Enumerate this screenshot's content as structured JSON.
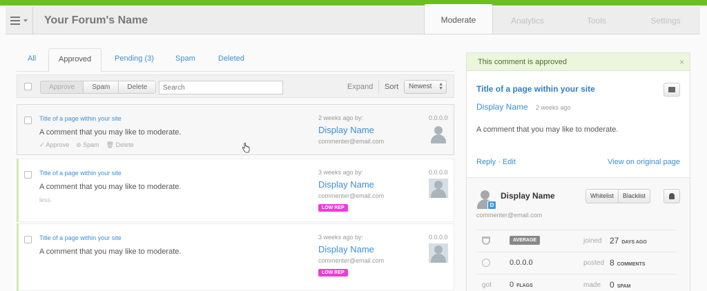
{
  "header": {
    "forum_name": "Your Forum's Name",
    "tabs": [
      {
        "label": "Moderate",
        "active": true
      },
      {
        "label": "Analytics"
      },
      {
        "label": "Tools"
      },
      {
        "label": "Settings"
      }
    ]
  },
  "filters": {
    "tabs": [
      {
        "label": "All"
      },
      {
        "label": "Approved",
        "active": true
      },
      {
        "label": "Pending (3)"
      },
      {
        "label": "Spam"
      },
      {
        "label": "Deleted"
      }
    ]
  },
  "toolbar": {
    "approve_label": "Approve",
    "spam_label": "Spam",
    "delete_label": "Delete",
    "search_placeholder": "Search",
    "expand_label": "Expand",
    "sort_label": "Sort",
    "sort_value": "Newest"
  },
  "comments": [
    {
      "title": "Title of a page within your site",
      "text": "A comment that you may like to moderate.",
      "time": "2 weeks ago by:",
      "name": "Display Name",
      "email": "commenter@email.com",
      "ip": "0.0.0.0",
      "actions": {
        "approve": "Approve",
        "spam": "Spam",
        "delete": "Delete"
      }
    },
    {
      "title": "Title of a page within your site",
      "text": "A comment that you may like to moderate.",
      "time": "3 weeks ago by:",
      "name": "Display Name",
      "email": "commenter@email.com",
      "ip": "0.0.0.0",
      "less": "less",
      "badge": "LOW REP"
    },
    {
      "title": "Title of a page within your site",
      "text": "A comment that you may like to moderate.",
      "time": "3 weeks ago by:",
      "name": "Display Name",
      "email": "commenter@email.com",
      "ip": "0.0.0.0",
      "badge": "LOW REP"
    }
  ],
  "detail": {
    "banner": "This comment is approved",
    "close": "×",
    "title": "Title of a page within your site",
    "name": "Display Name",
    "time": "2 weeks ago",
    "text": "A comment that you may like to moderate.",
    "reply": "Reply",
    "sep": "·",
    "edit": "Edit",
    "original": "View on original page",
    "user": {
      "badge_letter": "D",
      "name": "Display Name",
      "email": "commenter@email.com",
      "whitelist": "Whitelist",
      "blacklist": "Blacklist",
      "reputation": "AVERAGE",
      "joined_label": "joined",
      "joined_value": "27",
      "joined_unit": "DAYS AGO",
      "ip": "0.0.0.0",
      "posted_label": "posted",
      "posted_value": "8",
      "posted_unit": "COMMENTS",
      "got_label": "got",
      "flags_value": "0",
      "flags_unit": "FLAGS",
      "made_label": "made",
      "spam_value": "0",
      "spam_unit": "SPAM"
    }
  },
  "colors": {
    "brand_green": "#6cbf1f",
    "link_blue": "#3a8fd3",
    "low_rep": "#ee3cd5"
  }
}
